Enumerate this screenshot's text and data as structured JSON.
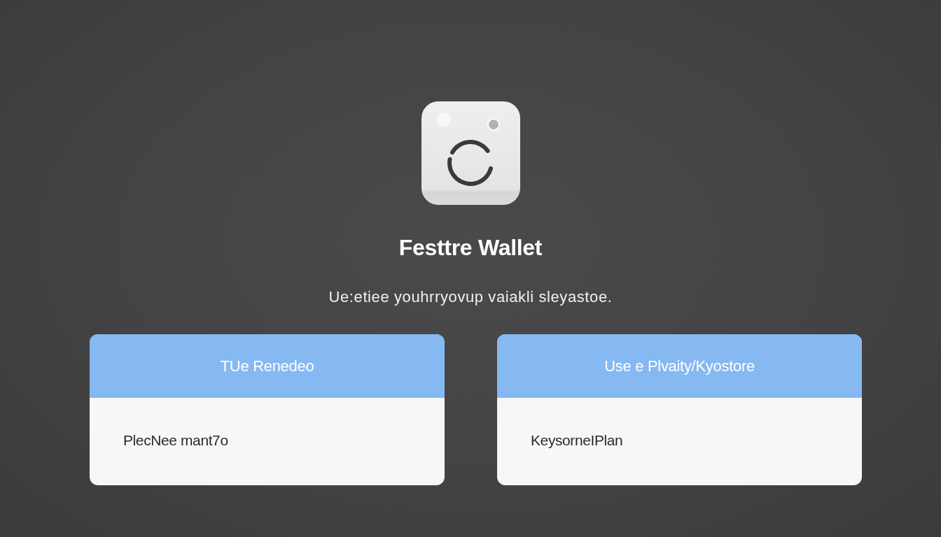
{
  "app": {
    "title": "Festtre Wallet",
    "subtitle": "Ue:etiee youhrryovup vaiakli sleyastoe."
  },
  "options": [
    {
      "title": "TUe Renedeo",
      "description": "PlecNee mant7o"
    },
    {
      "title": "Use e Plvaity/Kyostore",
      "description": "KeysorneIPlan"
    }
  ]
}
